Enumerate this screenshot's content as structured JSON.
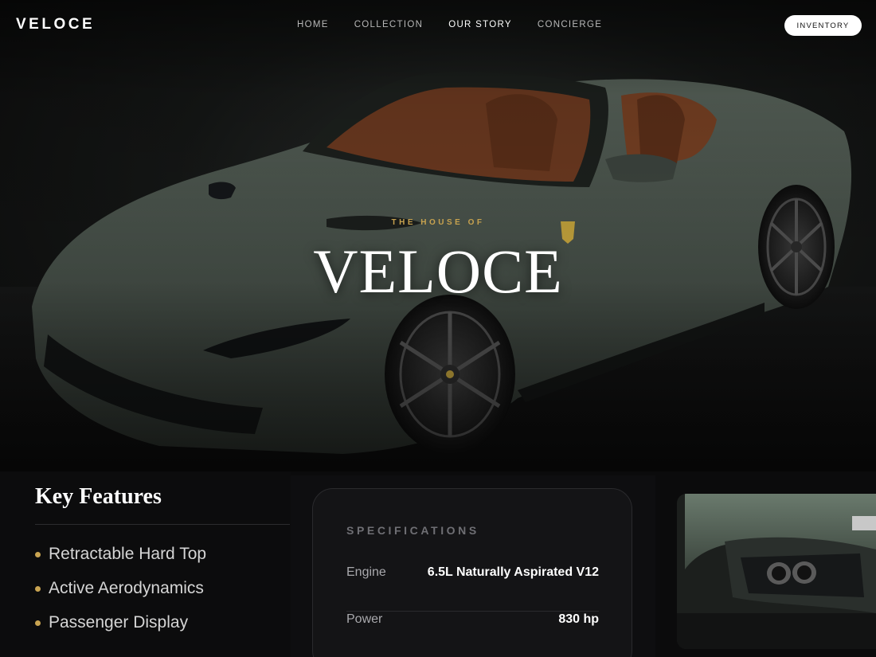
{
  "brand": {
    "logo": "VELOCE"
  },
  "nav": {
    "items": [
      {
        "label": "HOME",
        "active": false
      },
      {
        "label": "COLLECTION",
        "active": false
      },
      {
        "label": "OUR STORY",
        "active": true
      },
      {
        "label": "CONCIERGE",
        "active": false
      }
    ],
    "cta_label": "INVENTORY"
  },
  "hero": {
    "eyebrow": "THE HOUSE OF",
    "title": "VELOCE",
    "image": "green-convertible-supercar"
  },
  "features": {
    "heading": "Key Features",
    "items": [
      "Retractable Hard Top",
      "Active Aerodynamics",
      "Passenger Display"
    ]
  },
  "specifications": {
    "heading": "SPECIFICATIONS",
    "rows": [
      {
        "label": "Engine",
        "value": "6.5L Naturally Aspirated V12"
      },
      {
        "label": "Power",
        "value": "830 hp"
      }
    ]
  },
  "gallery": {
    "image": "rear-exhaust-detail"
  },
  "colors": {
    "accent": "#c7a24f",
    "car_body": "#48524a",
    "interior": "#7a3f22",
    "background": "#0b0b0c"
  }
}
